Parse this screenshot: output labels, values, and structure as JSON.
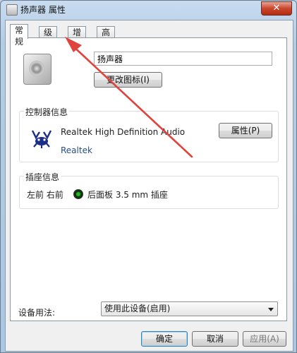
{
  "window": {
    "title": "扬声器 属性",
    "close_label": "✕"
  },
  "tabs": [
    {
      "label": "常规",
      "active": true
    },
    {
      "label": "级别",
      "active": false
    },
    {
      "label": "增强",
      "active": false
    },
    {
      "label": "高级",
      "active": false
    }
  ],
  "general": {
    "device_name": "扬声器",
    "change_icon_label": "更改图标(I)"
  },
  "controller": {
    "group_label": "控制器信息",
    "name": "Realtek High Definition Audio",
    "vendor": "Realtek",
    "properties_label": "属性(P)"
  },
  "jack": {
    "group_label": "插座信息",
    "position": "左前 右前",
    "description": "后面板 3.5 mm 插座",
    "color": "#1ea81e"
  },
  "usage": {
    "label": "设备用法:",
    "value": "使用此设备(启用)"
  },
  "footer": {
    "ok_label": "确定",
    "cancel_label": "取消",
    "apply_label": "应用(A)"
  },
  "colors": {
    "annotation_arrow": "#e0433b"
  }
}
